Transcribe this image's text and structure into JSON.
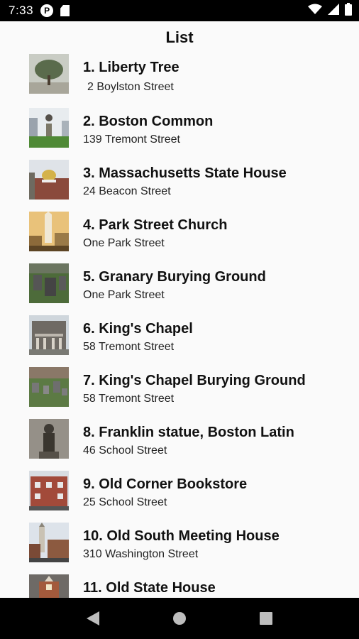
{
  "status_bar": {
    "time": "7:33",
    "app_icon": "p-circle-icon",
    "storage_icon": "sd-card-icon",
    "wifi_icon": "wifi-icon",
    "signal_icon": "cell-signal-icon",
    "battery_icon": "battery-icon"
  },
  "header": {
    "title": "List"
  },
  "places": [
    {
      "title": "1. Liberty Tree",
      "address": "2 Boylston Street",
      "thumb": "tree"
    },
    {
      "title": "2. Boston Common",
      "address": "139 Tremont Street",
      "thumb": "statue"
    },
    {
      "title": "3. Massachusetts State House",
      "address": "24 Beacon Street",
      "thumb": "dome"
    },
    {
      "title": "4. Park Street Church",
      "address": "One Park Street",
      "thumb": "church"
    },
    {
      "title": "5. Granary Burying Ground",
      "address": "One Park Street",
      "thumb": "graves"
    },
    {
      "title": "6. King's Chapel",
      "address": "58 Tremont Street",
      "thumb": "chapel"
    },
    {
      "title": "7. King's Chapel Burying Ground",
      "address": "58 Tremont Street",
      "thumb": "graves2"
    },
    {
      "title": "8. Franklin statue, Boston Latin",
      "address": "46 School Street",
      "thumb": "franklin"
    },
    {
      "title": "9. Old Corner Bookstore",
      "address": "25 School Street",
      "thumb": "brick"
    },
    {
      "title": "10. Old South Meeting House",
      "address": "310 Washington Street",
      "thumb": "steeple"
    },
    {
      "title": "11. Old State House",
      "address": "",
      "thumb": "statehouse"
    }
  ],
  "nav_bar": {
    "back_icon": "back-triangle-icon",
    "home_icon": "home-circle-icon",
    "recents_icon": "recents-square-icon"
  }
}
